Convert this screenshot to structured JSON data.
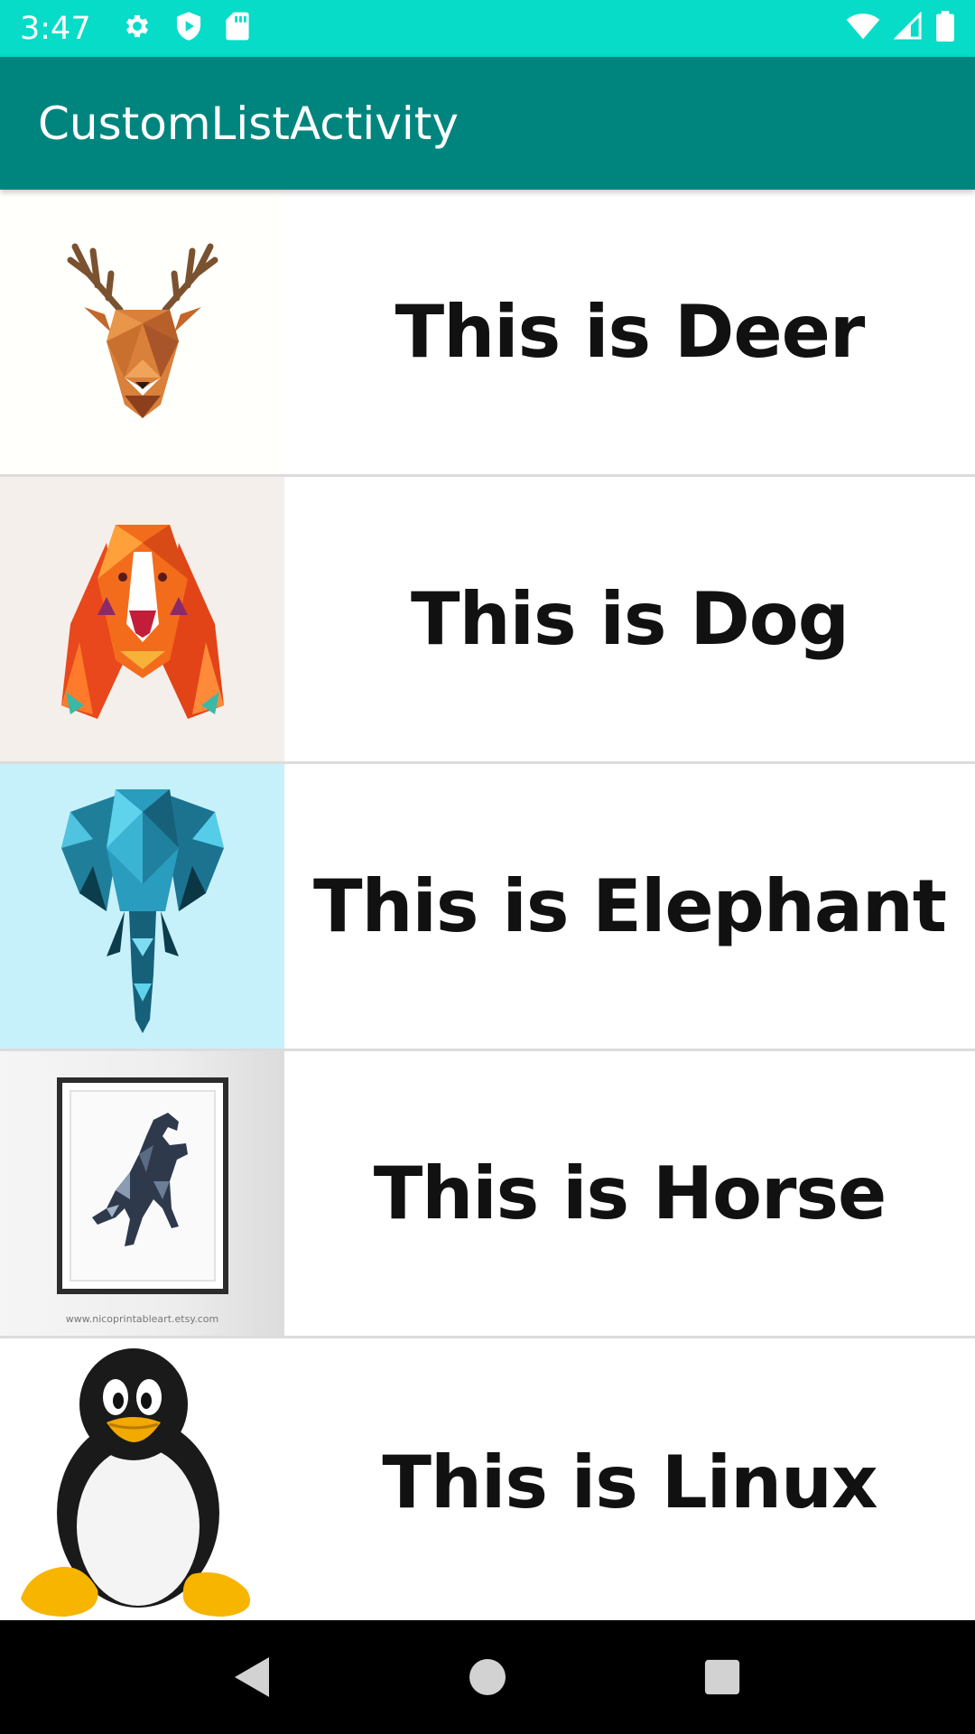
{
  "colors": {
    "status_bar": "#07dcc8",
    "app_bar": "#00857e",
    "nav_bar": "#000000"
  },
  "status_bar": {
    "time": "3:47",
    "left_icons": [
      "settings-gear-icon",
      "shield-play-icon",
      "sd-card-icon"
    ],
    "right_icons": [
      "wifi-icon",
      "cellular-signal-icon",
      "battery-icon"
    ]
  },
  "app_bar": {
    "title": "CustomListActivity"
  },
  "list": {
    "items": [
      {
        "label": "This is Deer",
        "image": "deer-image",
        "bg": "#fffffb"
      },
      {
        "label": "This is Dog",
        "image": "dog-image",
        "bg": "#f4efea"
      },
      {
        "label": "This is Elephant",
        "image": "elephant-image",
        "bg": "#c6f1fa"
      },
      {
        "label": "This is Horse",
        "image": "horse-image",
        "bg": "#efefef",
        "caption": "www.nicoprintableart.etsy.com"
      },
      {
        "label": "This is Linux",
        "image": "linux-penguin-image",
        "bg": "#ffffff"
      }
    ]
  },
  "nav_bar": {
    "buttons": [
      "back-icon",
      "home-icon",
      "recents-icon"
    ]
  }
}
